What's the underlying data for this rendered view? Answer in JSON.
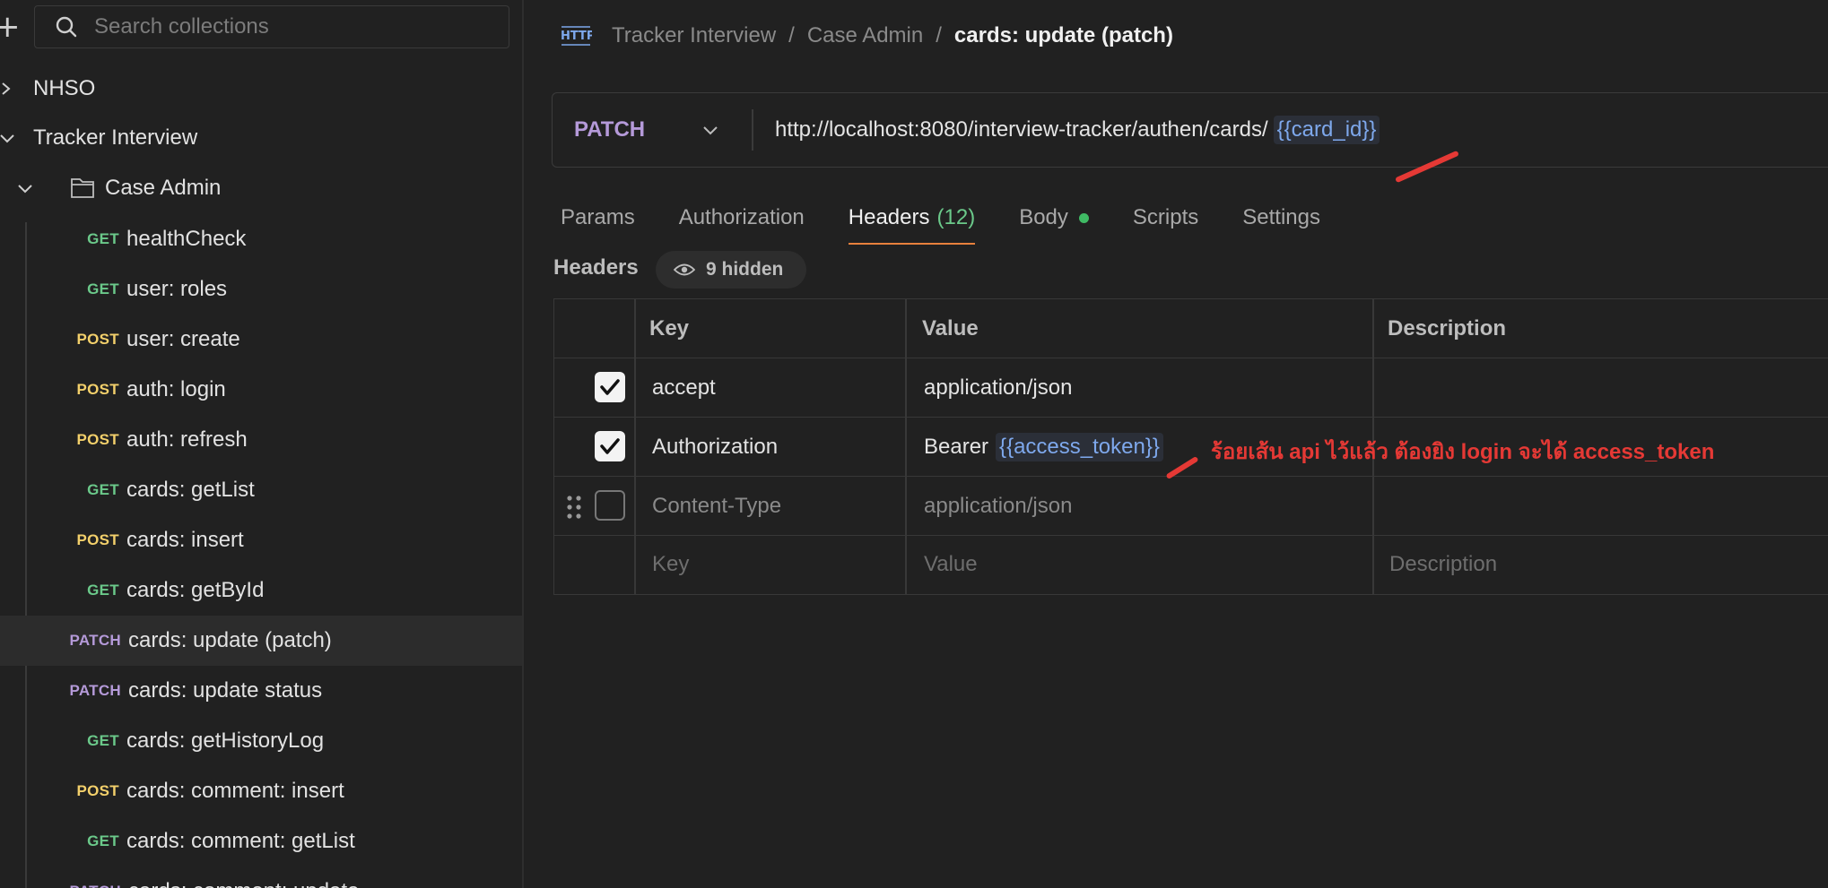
{
  "sidebar": {
    "search_placeholder": "Search collections",
    "collections": [
      {
        "label": "NHSO"
      },
      {
        "label": "Tracker Interview"
      }
    ],
    "folder": {
      "label": "Case Admin"
    },
    "requests": [
      {
        "method": "GET",
        "label": "healthCheck"
      },
      {
        "method": "GET",
        "label": "user: roles"
      },
      {
        "method": "POST",
        "label": "user: create"
      },
      {
        "method": "POST",
        "label": "auth: login"
      },
      {
        "method": "POST",
        "label": "auth: refresh"
      },
      {
        "method": "GET",
        "label": "cards: getList"
      },
      {
        "method": "POST",
        "label": "cards: insert"
      },
      {
        "method": "GET",
        "label": "cards: getById"
      },
      {
        "method": "PATCH",
        "label": "cards: update (patch)"
      },
      {
        "method": "PATCH",
        "label": "cards: update status"
      },
      {
        "method": "GET",
        "label": "cards: getHistoryLog"
      },
      {
        "method": "POST",
        "label": "cards: comment: insert"
      },
      {
        "method": "GET",
        "label": "cards: comment: getList"
      },
      {
        "method": "PATCH",
        "label": "cards: comment: update"
      }
    ]
  },
  "breadcrumb": {
    "collection": "Tracker Interview",
    "folder": "Case Admin",
    "current": "cards: update (patch)",
    "separator": "/"
  },
  "request": {
    "method": "PATCH",
    "url_base": "http://localhost:8080/interview-tracker/authen/cards/",
    "url_variable": "{{card_id}}"
  },
  "tabs": {
    "params": "Params",
    "authorization": "Authorization",
    "headers": "Headers",
    "headers_count": "(12)",
    "body": "Body",
    "scripts": "Scripts",
    "settings": "Settings"
  },
  "headers_section": {
    "title": "Headers",
    "hidden_label": "9 hidden",
    "columns": {
      "key": "Key",
      "value": "Value",
      "description": "Description"
    },
    "rows": [
      {
        "key": "accept",
        "value": "application/json",
        "enabled": true
      },
      {
        "key": "Authorization",
        "value_prefix": "Bearer",
        "value_variable": "{{access_token}}",
        "enabled": true
      },
      {
        "key": "Content-Type",
        "value": "application/json",
        "enabled": false
      }
    ],
    "new_row": {
      "key_placeholder": "Key",
      "value_placeholder": "Value",
      "description_placeholder": "Description"
    }
  },
  "annotation": {
    "text": "ร้อยเส้น api ไว้แล้ว ต้องยิง login จะได้ access_token",
    "color": "#e53935"
  },
  "colors": {
    "get": "#6bc98a",
    "post": "#f3d06b",
    "patch": "#b59ad9",
    "variable": "#7ea8ec",
    "active_tab_underline": "#e8813d"
  }
}
